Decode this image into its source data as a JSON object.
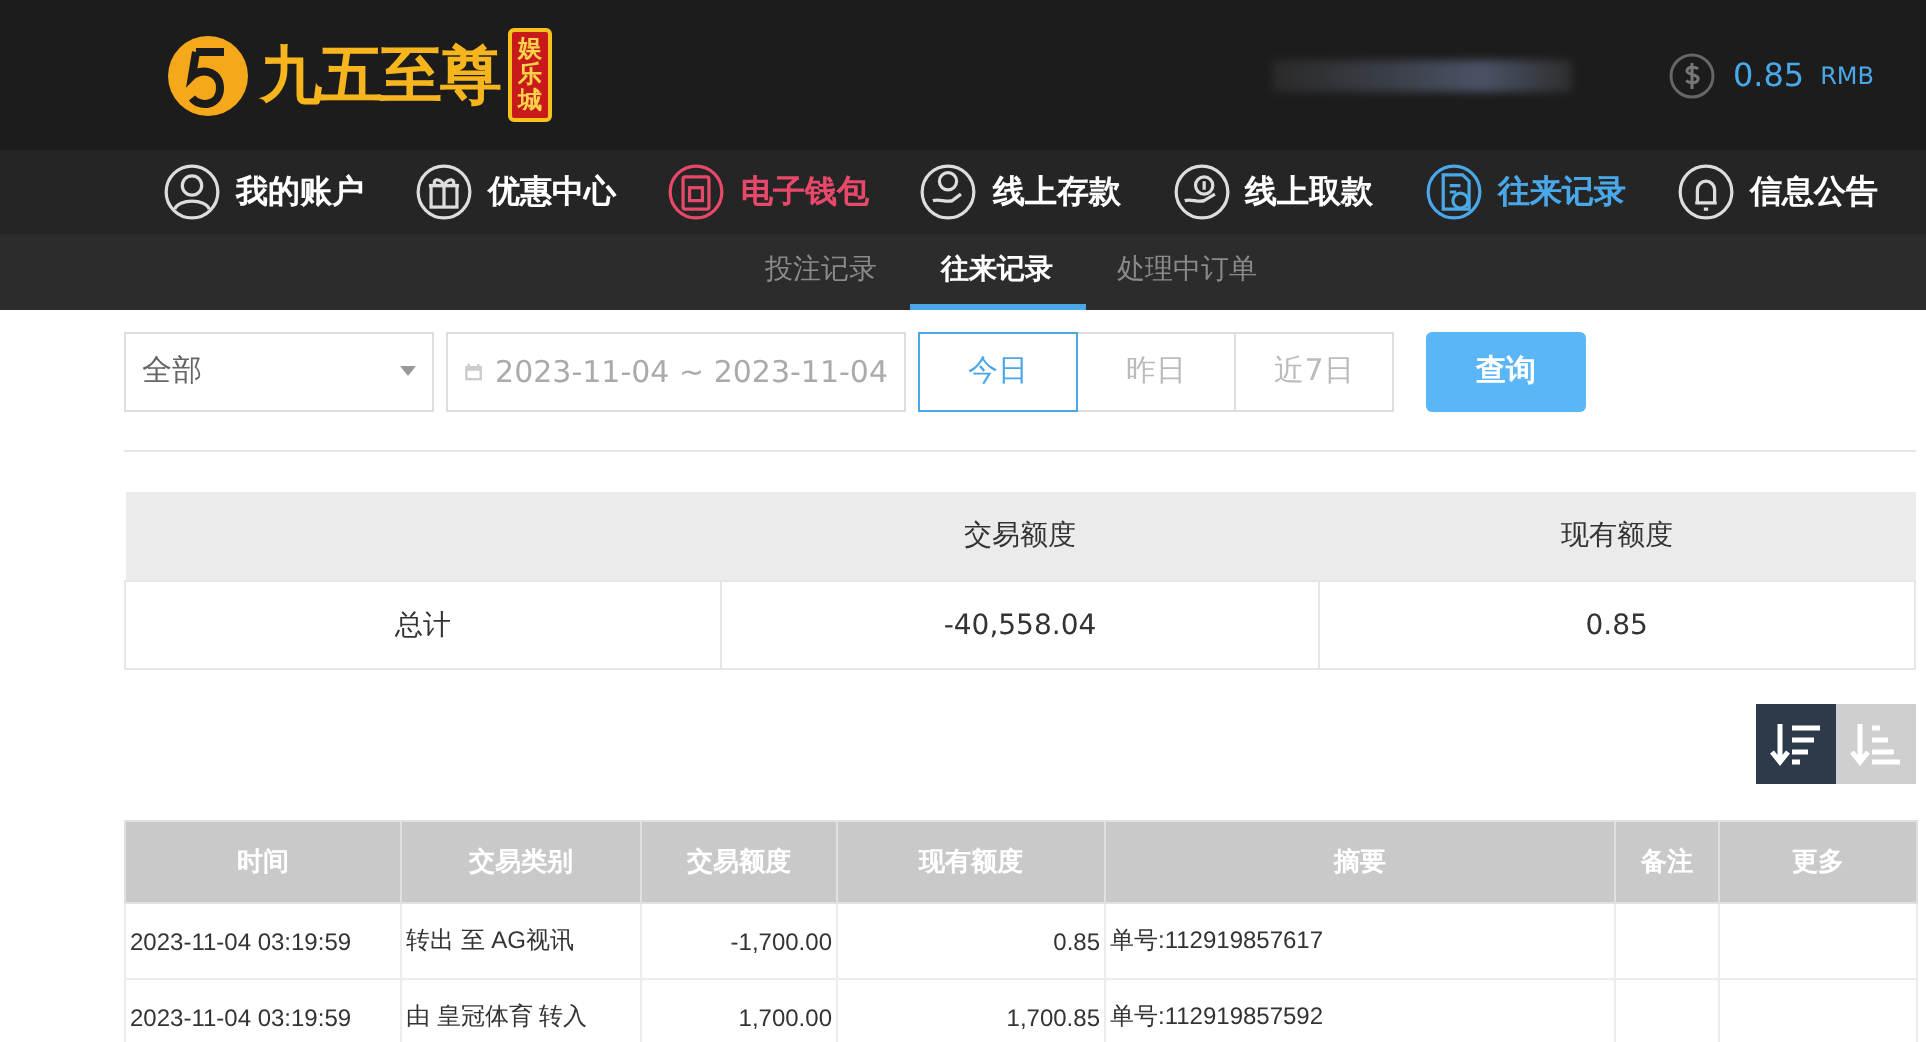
{
  "header": {
    "logo_title": "九五至尊",
    "logo_badge": "娱乐城",
    "balance": "0.85",
    "currency": "RMB"
  },
  "nav": [
    {
      "label": "我的账户",
      "color": "#ffffff"
    },
    {
      "label": "优惠中心",
      "color": "#ffffff"
    },
    {
      "label": "电子钱包",
      "color": "#e8496b"
    },
    {
      "label": "线上存款",
      "color": "#ffffff"
    },
    {
      "label": "线上取款",
      "color": "#ffffff"
    },
    {
      "label": "往来记录",
      "color": "#4aa8e8"
    },
    {
      "label": "信息公告",
      "color": "#ffffff"
    }
  ],
  "sub_tabs": [
    {
      "label": "投注记录",
      "selected": false
    },
    {
      "label": "往来记录",
      "selected": true
    },
    {
      "label": "处理中订单",
      "selected": false
    }
  ],
  "filter": {
    "type_select": "全部",
    "date_range": "2023-11-04 ~ 2023-11-04",
    "ranges": [
      {
        "label": "今日",
        "selected": true
      },
      {
        "label": "昨日",
        "selected": false
      },
      {
        "label": "近7日",
        "selected": false
      }
    ],
    "query_button": "查询"
  },
  "summary": {
    "columns": [
      "交易额度",
      "现有额度"
    ],
    "row": {
      "label": "总计",
      "values": [
        "-40,558.04",
        "0.85"
      ]
    }
  },
  "sort": [
    {
      "selected": true
    },
    {
      "selected": false
    }
  ],
  "table": {
    "columns": [
      "时间",
      "交易类别",
      "交易额度",
      "现有额度",
      "摘要",
      "备注",
      "更多"
    ],
    "rows": [
      [
        "2023-11-04 03:19:59",
        "转出 至 AG视讯",
        "-1,700.00",
        "0.85",
        "单号:112919857617",
        "",
        ""
      ],
      [
        "2023-11-04 03:19:59",
        "由 皇冠体育 转入",
        "1,700.00",
        "1,700.85",
        "单号:112919857592",
        "",
        ""
      ]
    ]
  }
}
